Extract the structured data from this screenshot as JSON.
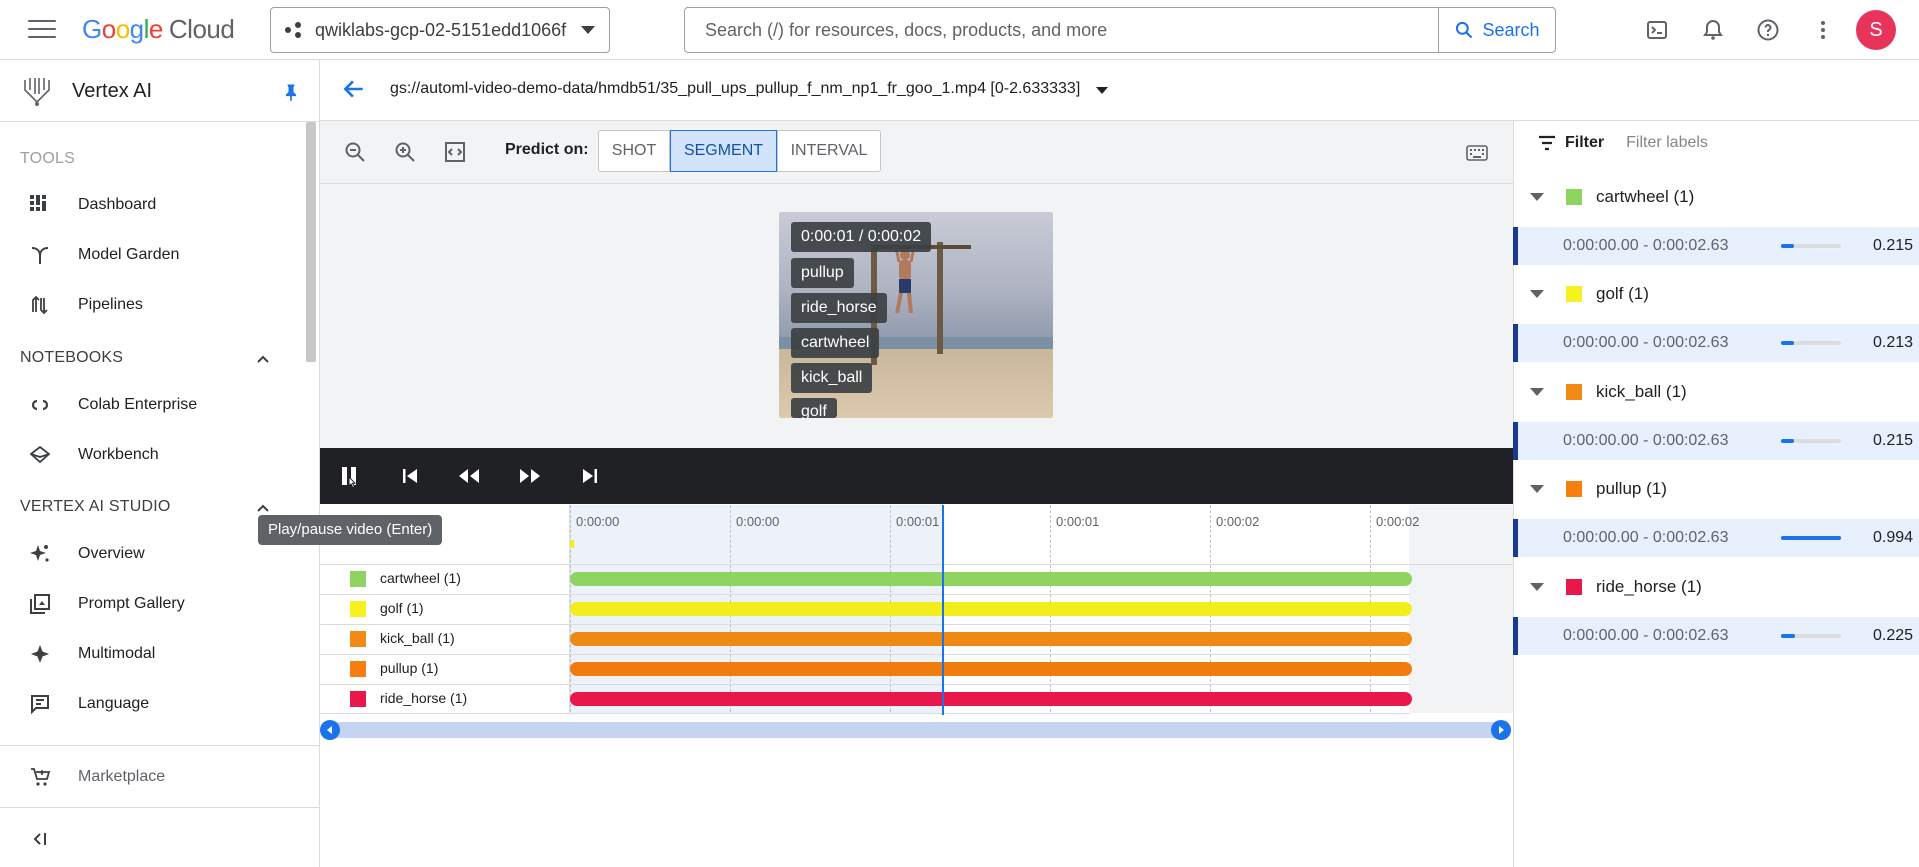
{
  "topbar": {
    "logo": [
      "G",
      "o",
      "o",
      "g",
      "l",
      "e"
    ],
    "logo_suffix": "Cloud",
    "project": "qwiklabs-gcp-02-5151edd1066f",
    "search_placeholder": "Search (/) for resources, docs, products, and more",
    "search_button": "Search",
    "avatar_initial": "S"
  },
  "sidebar": {
    "title": "Vertex AI",
    "sections": {
      "tools": "TOOLS",
      "notebooks": "NOTEBOOKS",
      "studio": "VERTEX AI STUDIO"
    },
    "items": {
      "dashboard": "Dashboard",
      "model_garden": "Model Garden",
      "pipelines": "Pipelines",
      "colab": "Colab Enterprise",
      "workbench": "Workbench",
      "overview": "Overview",
      "prompt_gallery": "Prompt Gallery",
      "multimodal": "Multimodal",
      "language": "Language",
      "marketplace": "Marketplace"
    }
  },
  "header": {
    "path": "gs://automl-video-demo-data/hmdb51/35_pull_ups_pullup_f_nm_np1_fr_goo_1.mp4 [0-2.633333]"
  },
  "toolbar": {
    "predict_on": "Predict on:",
    "modes": [
      "SHOT",
      "SEGMENT",
      "INTERVAL"
    ],
    "active_mode": "SEGMENT"
  },
  "video": {
    "time": "0:00:01 / 0:00:02",
    "overlay_labels": [
      "pullup",
      "ride_horse",
      "cartwheel",
      "kick_ball",
      "golf"
    ]
  },
  "controls": {
    "tooltip": "Play/pause video (Enter)"
  },
  "timeline": {
    "ticks": [
      "0:00:00",
      "0:00:00",
      "0:00:01",
      "0:00:01",
      "0:00:02",
      "0:00:02"
    ],
    "rows": [
      {
        "label": "cartwheel (1)",
        "color": "#8fd460",
        "bar": "#8fd460"
      },
      {
        "label": "golf (1)",
        "color": "#f7f11f",
        "bar": "#f2ee1d"
      },
      {
        "label": "kick_ball (1)",
        "color": "#f28a16",
        "bar": "#ee8a14"
      },
      {
        "label": "pullup (1)",
        "color": "#f57e0f",
        "bar": "#f07c10"
      },
      {
        "label": "ride_horse (1)",
        "color": "#e8194a",
        "bar": "#e8194a"
      }
    ]
  },
  "panel": {
    "filter_label": "Filter",
    "filter_placeholder": "Filter labels",
    "labels": [
      {
        "name": "cartwheel (1)",
        "color": "#8fd460",
        "range": "0:00:00.00 - 0:00:02.63",
        "score": "0.215",
        "fraction": 0.215
      },
      {
        "name": "golf (1)",
        "color": "#f7f11f",
        "range": "0:00:00.00 - 0:00:02.63",
        "score": "0.213",
        "fraction": 0.213
      },
      {
        "name": "kick_ball (1)",
        "color": "#f28a16",
        "range": "0:00:00.00 - 0:00:02.63",
        "score": "0.215",
        "fraction": 0.215
      },
      {
        "name": "pullup (1)",
        "color": "#f57e0f",
        "range": "0:00:00.00 - 0:00:02.63",
        "score": "0.994",
        "fraction": 0.994
      },
      {
        "name": "ride_horse (1)",
        "color": "#e8194a",
        "range": "0:00:00.00 - 0:00:02.63",
        "score": "0.225",
        "fraction": 0.225
      }
    ]
  }
}
